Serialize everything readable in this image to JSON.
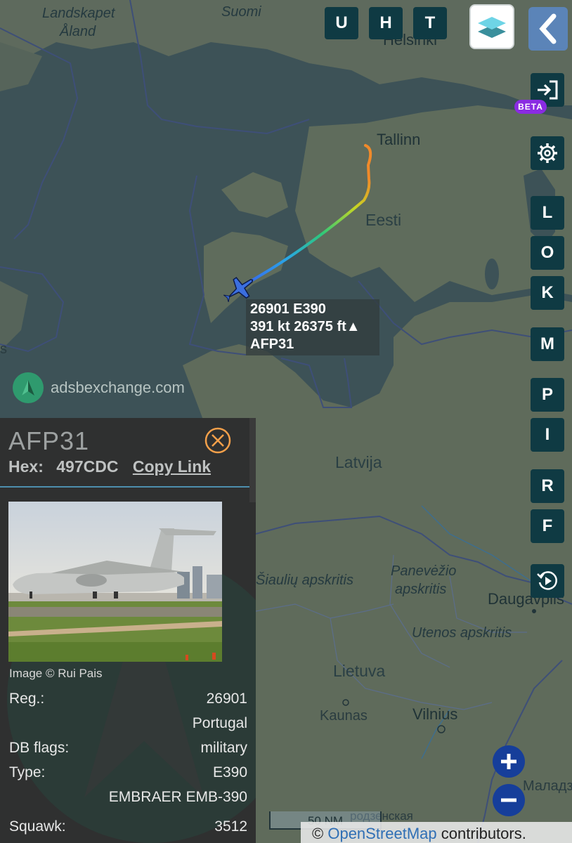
{
  "map": {
    "places": {
      "landskapet_aland_1": "Landskapet",
      "landskapet_aland_2": "Åland",
      "suomi": "Suomi",
      "helsinki": "Helsinki",
      "tallinn": "Tallinn",
      "eesti": "Eesti",
      "latvija": "Latvija",
      "panevezio_1": "Panevėžio",
      "panevezio_2": "apskritis",
      "siauliu": "Šiaulių apskritis",
      "daugavpils": "Daugavpils",
      "utenos": "Utenos apskritis",
      "lietuva": "Lietuva",
      "kaunas": "Kaunas",
      "vilnius": "Vilnius",
      "maladzech": "Маладзеч",
      "sodenskaya": "родзенская",
      "small_s": "s"
    },
    "scale_label": "50 NM",
    "attribution_symbol": "©",
    "attribution_link": "OpenStreetMap",
    "attribution_text": "contributors."
  },
  "branding": {
    "site": "adsbexchange.com"
  },
  "top_buttons": [
    "U",
    "H",
    "T"
  ],
  "side_buttons": [
    "L",
    "O",
    "K",
    "M",
    "P",
    "I",
    "R",
    "F"
  ],
  "beta_badge": "BETA",
  "callout": {
    "line1": "26901 E390",
    "line2": "391 kt  26375 ft▲",
    "line3": "AFP31"
  },
  "panel": {
    "callsign": "AFP31",
    "hex_label": "Hex:",
    "hex_value": "497CDC",
    "copy_link": "Copy Link",
    "image_credit": "Image © Rui Pais",
    "reg_label": "Reg.:",
    "reg_value": "26901",
    "country_value": "Portugal",
    "dbflags_label": "DB flags:",
    "dbflags_value": "military",
    "type_label": "Type:",
    "type_value": "E390",
    "type_full": "EMBRAER EMB-390",
    "squawk_label": "Squawk:",
    "squawk_value": "3512"
  },
  "colors": {
    "button_bg": "#0f3a43",
    "beta": "#8a2be2",
    "panel_bg": "#2f3030",
    "accent_orange": "#f5a04a",
    "aircraft": "#3b6fe0"
  }
}
